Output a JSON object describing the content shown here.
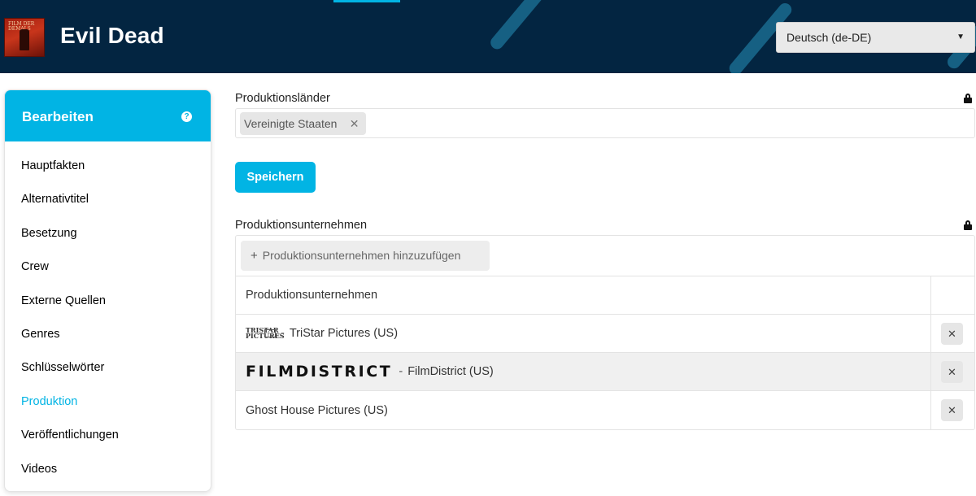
{
  "header": {
    "title": "Evil Dead",
    "poster_text": "FILM DER DEMALS",
    "language": "Deutsch (de-DE)"
  },
  "sidebar": {
    "heading": "Bearbeiten",
    "help_glyph": "?",
    "items": [
      {
        "label": "Hauptfakten"
      },
      {
        "label": "Alternativtitel"
      },
      {
        "label": "Besetzung"
      },
      {
        "label": "Crew"
      },
      {
        "label": "Externe Quellen"
      },
      {
        "label": "Genres"
      },
      {
        "label": "Schlüsselwörter"
      },
      {
        "label": "Produktion",
        "active": true
      },
      {
        "label": "Veröffentlichungen"
      },
      {
        "label": "Videos"
      }
    ]
  },
  "production_countries": {
    "label": "Produktionsländer",
    "chips": [
      {
        "label": "Vereinigte Staaten",
        "remove_glyph": "✕"
      }
    ]
  },
  "save_label": "Speichern",
  "production_companies": {
    "label": "Produktionsunternehmen",
    "add_label": "Produktionsunternehmen hinzuzufügen",
    "add_glyph": "+",
    "column_header": "Produktionsunternehmen",
    "rows": [
      {
        "logo": "TriStar Pictures",
        "logo_text": "TRISTAR PICTURES",
        "separator": "-",
        "name": "TriStar Pictures (US)"
      },
      {
        "logo": "FilmDistrict",
        "logo_text": "FILMDISTRICT",
        "separator": "-",
        "name": "FilmDistrict (US)"
      },
      {
        "logo": null,
        "name": "Ghost House Pictures (US)"
      }
    ],
    "remove_glyph": "✕"
  },
  "colors": {
    "header_bg": "#032541",
    "accent": "#01b4e4"
  }
}
